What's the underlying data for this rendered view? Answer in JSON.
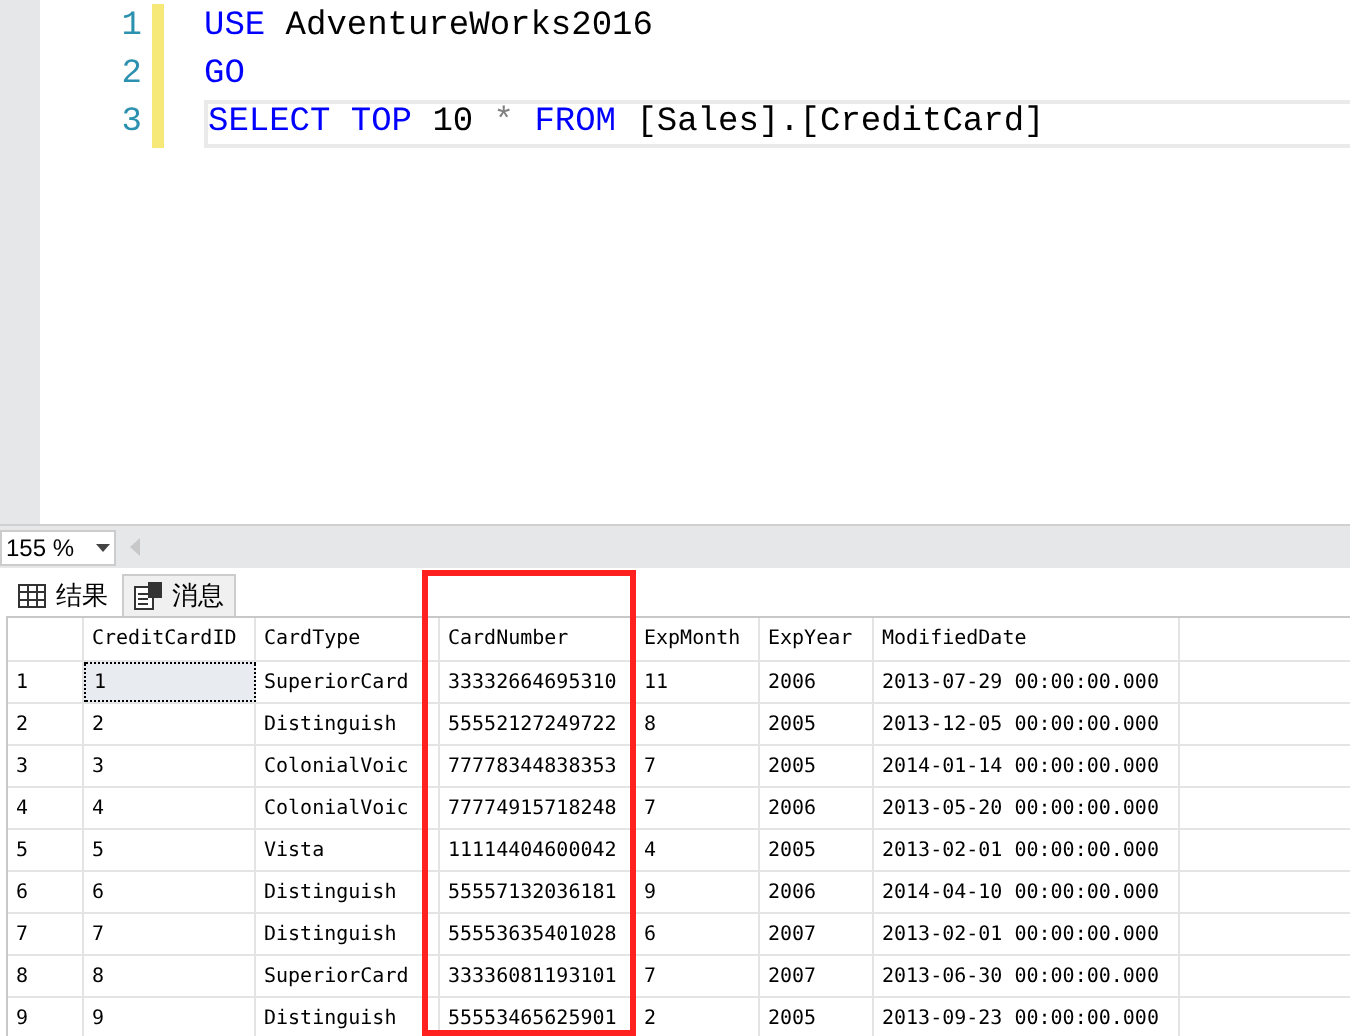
{
  "editor": {
    "lines": [
      {
        "number": "1",
        "tokens": [
          {
            "kind": "keyword",
            "text": "USE"
          },
          {
            "kind": "plain",
            "text": "AdventureWorks2016"
          }
        ],
        "current": false
      },
      {
        "number": "2",
        "tokens": [
          {
            "kind": "keyword",
            "text": "GO"
          }
        ],
        "current": false
      },
      {
        "number": "3",
        "tokens": [
          {
            "kind": "keyword",
            "text": "SELECT"
          },
          {
            "kind": "keyword",
            "text": "TOP"
          },
          {
            "kind": "plain",
            "text": "10"
          },
          {
            "kind": "operator",
            "text": "*"
          },
          {
            "kind": "keyword",
            "text": "FROM"
          },
          {
            "kind": "plain",
            "text": "[Sales].[CreditCard]"
          }
        ],
        "current": true
      }
    ]
  },
  "zoom": {
    "value": "155 %"
  },
  "tabs": [
    {
      "label": "结果",
      "selected": true
    },
    {
      "label": "消息",
      "selected": false
    }
  ],
  "grid": {
    "columns": [
      "CreditCardID",
      "CardType",
      "CardNumber",
      "ExpMonth",
      "ExpYear",
      "ModifiedDate"
    ],
    "rows": [
      {
        "number": "1",
        "focused": true,
        "cells": [
          "1",
          "SuperiorCard",
          "33332664695310",
          "11",
          "2006",
          "2013-07-29 00:00:00.000"
        ]
      },
      {
        "number": "2",
        "focused": false,
        "cells": [
          "2",
          "Distinguish",
          "55552127249722",
          "8",
          "2005",
          "2013-12-05 00:00:00.000"
        ]
      },
      {
        "number": "3",
        "focused": false,
        "cells": [
          "3",
          "ColonialVoic",
          "77778344838353",
          "7",
          "2005",
          "2014-01-14 00:00:00.000"
        ]
      },
      {
        "number": "4",
        "focused": false,
        "cells": [
          "4",
          "ColonialVoic",
          "77774915718248",
          "7",
          "2006",
          "2013-05-20 00:00:00.000"
        ]
      },
      {
        "number": "5",
        "focused": false,
        "cells": [
          "5",
          "Vista",
          "11114404600042",
          "4",
          "2005",
          "2013-02-01 00:00:00.000"
        ]
      },
      {
        "number": "6",
        "focused": false,
        "cells": [
          "6",
          "Distinguish",
          "55557132036181",
          "9",
          "2006",
          "2014-04-10 00:00:00.000"
        ]
      },
      {
        "number": "7",
        "focused": false,
        "cells": [
          "7",
          "Distinguish",
          "55553635401028",
          "6",
          "2007",
          "2013-02-01 00:00:00.000"
        ]
      },
      {
        "number": "8",
        "focused": false,
        "cells": [
          "8",
          "SuperiorCard",
          "33336081193101",
          "7",
          "2007",
          "2013-06-30 00:00:00.000"
        ]
      },
      {
        "number": "9",
        "focused": false,
        "cells": [
          "9",
          "Distinguish",
          "55553465625901",
          "2",
          "2005",
          "2013-09-23 00:00:00.000"
        ]
      }
    ]
  }
}
